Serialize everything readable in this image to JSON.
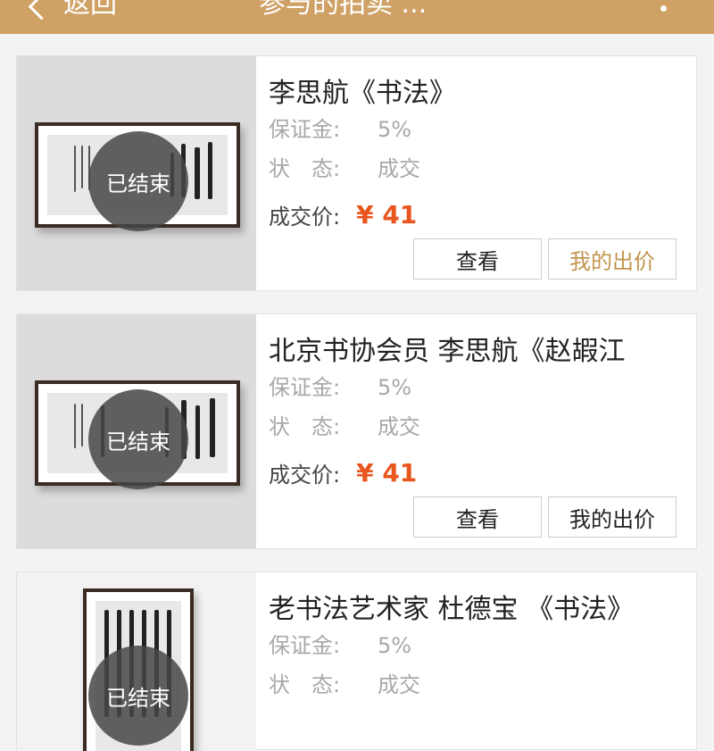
{
  "header": {
    "back_label": "返回",
    "title": "参与的拍卖 ..."
  },
  "colors": {
    "header_bg": "#cfa165",
    "price": "#e8561e",
    "bid_gold": "#c2954d"
  },
  "cards": [
    {
      "name": "李思航《书法》",
      "status_overlay": "已结束",
      "deposit_label": "保证金:",
      "deposit_value": "5%",
      "state_label": "状　态:",
      "state_value": "成交",
      "price_label": "成交价:",
      "price_value": "¥ 41",
      "view_label": "查看",
      "bid_label": "我的出价",
      "bid_color": "#c2954d"
    },
    {
      "name": "北京书协会员 李思航《赵嘏江",
      "status_overlay": "已结束",
      "deposit_label": "保证金:",
      "deposit_value": "5%",
      "state_label": "状　态:",
      "state_value": "成交",
      "price_label": "成交价:",
      "price_value": "¥ 41",
      "view_label": "查看",
      "bid_label": "我的出价",
      "bid_color": "#222222"
    },
    {
      "name": "老书法艺术家  杜德宝 《书法》",
      "status_overlay": "已结束",
      "deposit_label": "保证金:",
      "deposit_value": "5%",
      "state_label": "状　态:",
      "state_value": "成交"
    }
  ]
}
